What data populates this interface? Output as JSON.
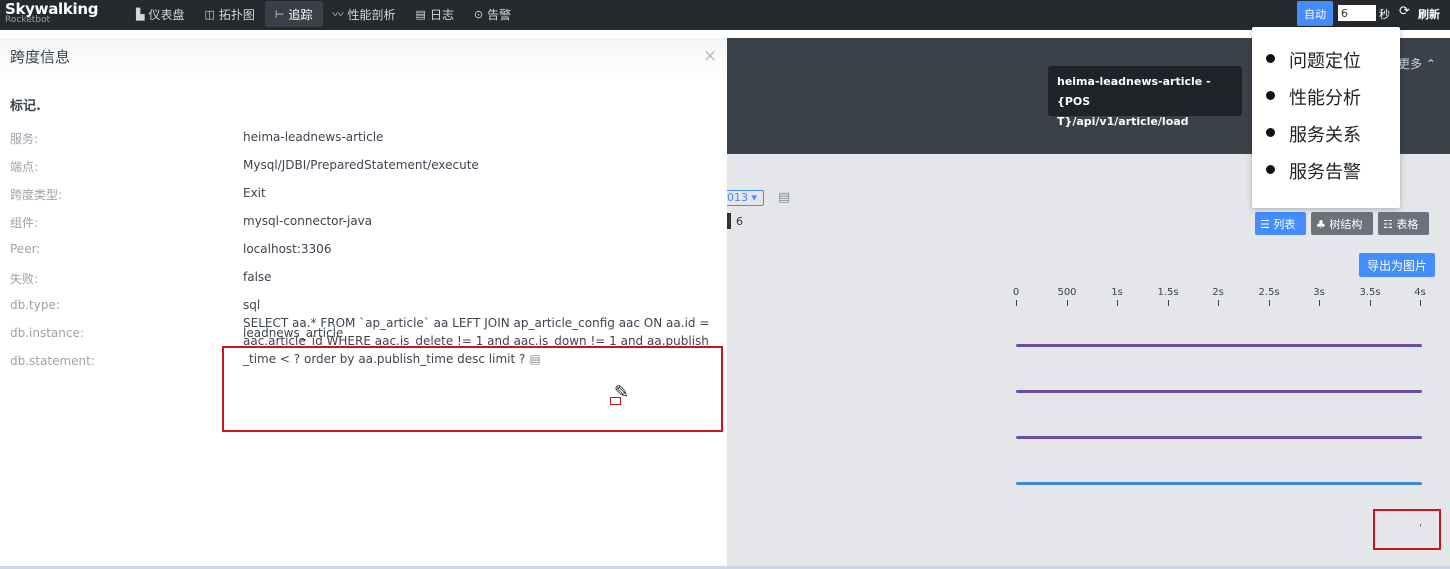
{
  "app": {
    "logo_main": "Skywalking",
    "logo_sub": "Rocketbot"
  },
  "nav": [
    {
      "icon": "▙",
      "label": "仪表盘"
    },
    {
      "icon": "◫",
      "label": "拓扑图"
    },
    {
      "icon": "⊢",
      "label": "追踪"
    },
    {
      "icon": "〰",
      "label": "性能剖析"
    },
    {
      "icon": "▤",
      "label": "日志"
    },
    {
      "icon": "⊙",
      "label": "告警"
    }
  ],
  "refresh": {
    "auto_label": "自动",
    "interval_value": "6",
    "sec_label": "秒",
    "refresh_icon": "⟳",
    "refresh_label": "刷新"
  },
  "dropdown": {
    "items": [
      "问题定位",
      "性能分析",
      "服务关系",
      "服务告警"
    ]
  },
  "background": {
    "more_label": "更多 ⌃",
    "tooltip_line1": "heima-leadnews-article - {POS",
    "tooltip_line2": "T}/api/v1/article/load",
    "trace_select": "013 ▾",
    "span_count": "6",
    "view_list": "☰ 列表",
    "view_tree": "♣ 树结构",
    "view_table": "☷ 表格",
    "export_label": "导出为图片",
    "axis_ticks": [
      "0",
      "500",
      "1s",
      "1.5s",
      "2s",
      "2.5s",
      "3s",
      "3.5s",
      "4s"
    ],
    "small_mark": "'"
  },
  "panel": {
    "title": "跨度信息",
    "close": "×",
    "section": "标记.",
    "rows": [
      {
        "key": "服务:",
        "value": "heima-leadnews-article"
      },
      {
        "key": "端点:",
        "value": "Mysql/JDBI/PreparedStatement/execute"
      },
      {
        "key": "跨度类型:",
        "value": "Exit"
      },
      {
        "key": "组件:",
        "value": "mysql-connector-java"
      },
      {
        "key": "Peer:",
        "value": "localhost:3306"
      },
      {
        "key": "失败:",
        "value": "false"
      },
      {
        "key": "db.type:",
        "value": "sql"
      },
      {
        "key": "db.instance:",
        "value": "leadnews_article"
      },
      {
        "key": "db.statement:",
        "value": ""
      }
    ],
    "statement": "SELECT aa.* FROM `ap_article` aa LEFT JOIN ap_article_config aac ON aa.id = aac.article_id WHERE aac.is_delete != 1 and aac.is_down != 1 and aa.publish_time < ? order by aa.publish_time desc limit ?",
    "copy_icon": "▤"
  },
  "colors": {
    "topbar": "#252a2f",
    "accent": "#448dfe",
    "span_purple": "#6d4ba8",
    "span_blue": "#3d8ad8",
    "highlight_red": "#c8161d"
  }
}
